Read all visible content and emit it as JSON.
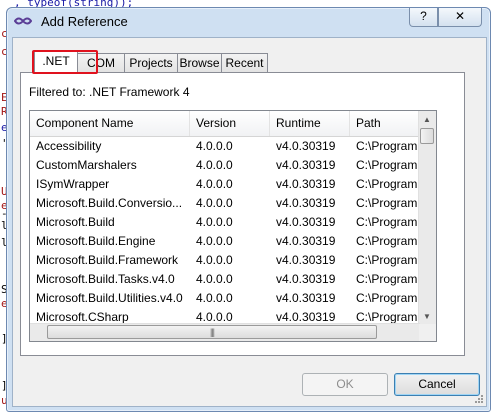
{
  "background": {
    "code_top": ", typeof(string));"
  },
  "dialog": {
    "title": "Add Reference",
    "help_label": "?",
    "close_label": "✕"
  },
  "tabs": [
    {
      "label": ".NET",
      "active": true
    },
    {
      "label": "COM"
    },
    {
      "label": "Projects"
    },
    {
      "label": "Browse"
    },
    {
      "label": "Recent"
    }
  ],
  "filter_text": "Filtered to: .NET Framework 4",
  "grid": {
    "columns": [
      "Component Name",
      "Version",
      "Runtime",
      "Path"
    ],
    "rows": [
      [
        "Accessibility",
        "4.0.0.0",
        "v4.0.30319",
        "C:\\Program"
      ],
      [
        "CustomMarshalers",
        "4.0.0.0",
        "v4.0.30319",
        "C:\\Program"
      ],
      [
        "ISymWrapper",
        "4.0.0.0",
        "v4.0.30319",
        "C:\\Program"
      ],
      [
        "Microsoft.Build.Conversio...",
        "4.0.0.0",
        "v4.0.30319",
        "C:\\Program"
      ],
      [
        "Microsoft.Build",
        "4.0.0.0",
        "v4.0.30319",
        "C:\\Program"
      ],
      [
        "Microsoft.Build.Engine",
        "4.0.0.0",
        "v4.0.30319",
        "C:\\Program"
      ],
      [
        "Microsoft.Build.Framework",
        "4.0.0.0",
        "v4.0.30319",
        "C:\\Program"
      ],
      [
        "Microsoft.Build.Tasks.v4.0",
        "4.0.0.0",
        "v4.0.30319",
        "C:\\Program"
      ],
      [
        "Microsoft.Build.Utilities.v4.0",
        "4.0.0.0",
        "v4.0.30319",
        "C:\\Program"
      ],
      [
        "Microsoft.CSharp",
        "4.0.0.0",
        "v4.0.30319",
        "C:\\Program"
      ]
    ]
  },
  "buttons": {
    "ok": "OK",
    "cancel": "Cancel"
  },
  "colors": {
    "highlight": "#e0121e",
    "dialog_frame": "#cfe0f2"
  }
}
